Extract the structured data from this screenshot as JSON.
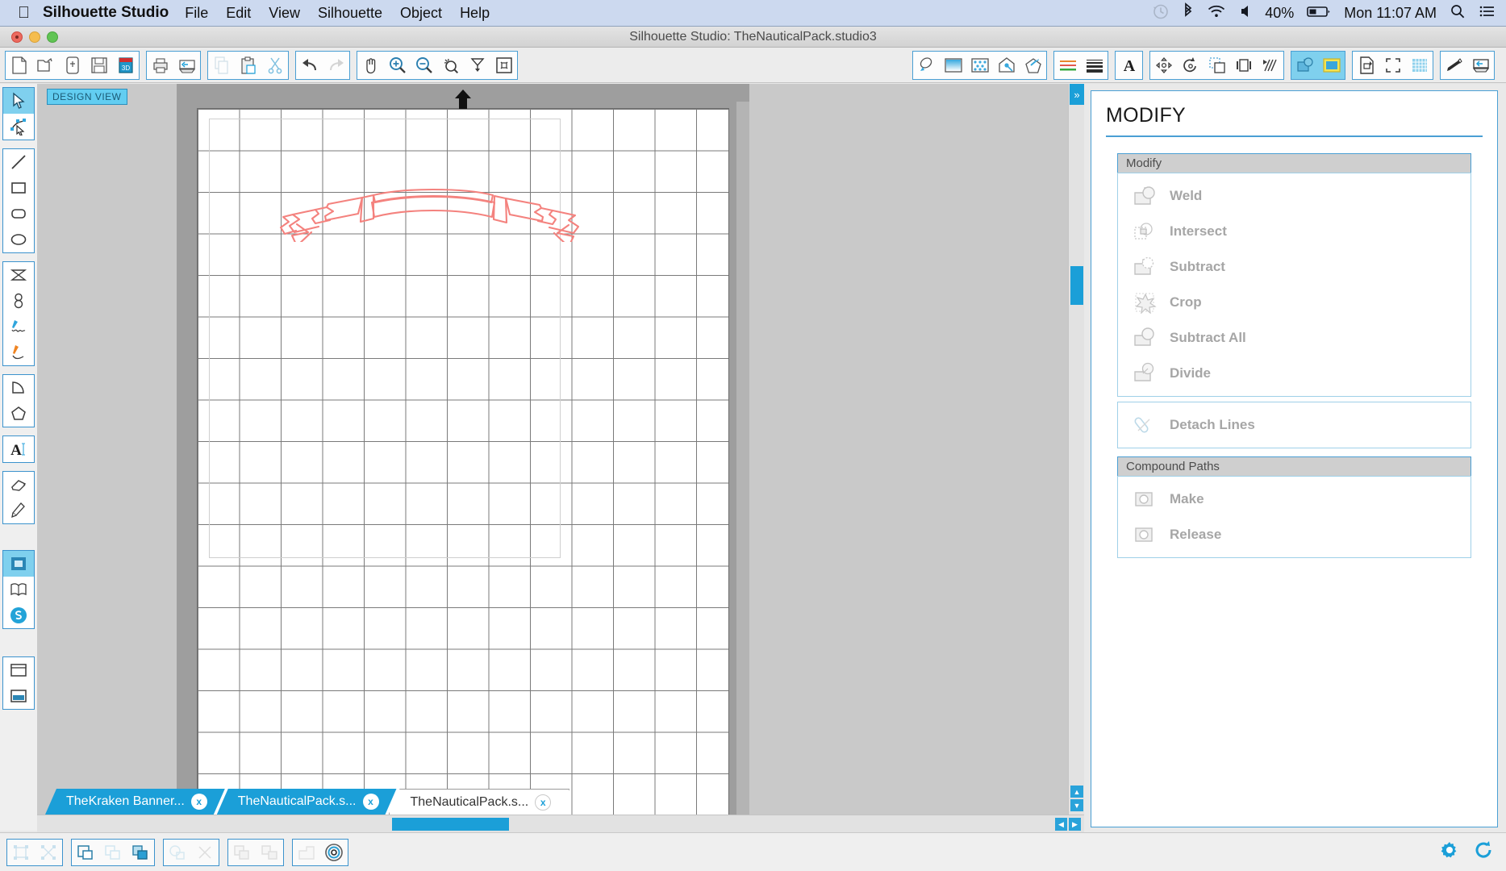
{
  "menubar": {
    "apple_icon": "apple-icon",
    "app_name": "Silhouette Studio",
    "items": [
      "File",
      "Edit",
      "View",
      "Silhouette",
      "Object",
      "Help"
    ],
    "status": {
      "timemachine_icon": "time-machine-icon",
      "bluetooth_icon": "bluetooth-icon",
      "wifi_icon": "wifi-icon",
      "volume_icon": "volume-icon",
      "battery_percent": "40%",
      "battery_icon": "battery-icon",
      "clock": "Mon 11:07 AM",
      "search_icon": "search-icon",
      "notifications_icon": "notification-list-icon"
    }
  },
  "window": {
    "title": "Silhouette Studio: TheNauticalPack.studio3",
    "close_label": "",
    "minimize_label": "",
    "zoom_label": ""
  },
  "toolbar": {
    "groups": [
      {
        "name": "file",
        "buttons": [
          {
            "name": "new-document-button",
            "icon": "new-page-icon"
          },
          {
            "name": "open-document-button",
            "icon": "open-folder-icon"
          },
          {
            "name": "open-from-library-button",
            "icon": "card-icon"
          },
          {
            "name": "save-button",
            "icon": "floppy-disk-icon"
          },
          {
            "name": "save-as-button",
            "icon": "save-as-3d-icon"
          }
        ]
      },
      {
        "name": "print",
        "buttons": [
          {
            "name": "print-button",
            "icon": "printer-icon"
          },
          {
            "name": "send-to-silhouette-button",
            "icon": "cut-send-icon"
          }
        ]
      },
      {
        "name": "clipboard",
        "buttons": [
          {
            "name": "copy-button",
            "icon": "copy-icon"
          },
          {
            "name": "paste-button",
            "icon": "paste-icon"
          },
          {
            "name": "cut-button",
            "icon": "scissors-icon"
          }
        ]
      },
      {
        "name": "history",
        "buttons": [
          {
            "name": "undo-button",
            "icon": "undo-arrow-icon"
          },
          {
            "name": "redo-button",
            "icon": "redo-arrow-icon"
          }
        ]
      },
      {
        "name": "view",
        "buttons": [
          {
            "name": "pan-tool-button",
            "icon": "hand-icon"
          },
          {
            "name": "zoom-in-button",
            "icon": "zoom-in-icon"
          },
          {
            "name": "zoom-out-button",
            "icon": "zoom-out-icon"
          },
          {
            "name": "zoom-selection-button",
            "icon": "zoom-selection-icon"
          },
          {
            "name": "fit-to-window-button",
            "icon": "fit-window-icon"
          },
          {
            "name": "fit-to-page-button",
            "icon": "fit-page-icon"
          }
        ]
      },
      {
        "name": "style",
        "buttons": [
          {
            "name": "line-color-button",
            "icon": "line-color-icon"
          },
          {
            "name": "fill-color-button",
            "icon": "fill-color-icon"
          },
          {
            "name": "pattern-fill-button",
            "icon": "pattern-fill-icon"
          },
          {
            "name": "gradient-fill-button",
            "icon": "gradient-fill-icon"
          },
          {
            "name": "sketch-fill-button",
            "icon": "sketch-pen-icon"
          }
        ]
      },
      {
        "name": "line",
        "buttons": [
          {
            "name": "line-style-button",
            "icon": "line-style-icon"
          },
          {
            "name": "line-thickness-button",
            "icon": "line-thickness-icon"
          }
        ]
      },
      {
        "name": "text",
        "buttons": [
          {
            "name": "text-style-button",
            "icon": "text-A-icon"
          }
        ]
      },
      {
        "name": "transform",
        "buttons": [
          {
            "name": "move-button",
            "icon": "move-arrows-icon"
          },
          {
            "name": "rotate-button",
            "icon": "rotate-icon"
          },
          {
            "name": "scale-button",
            "icon": "scale-icon"
          },
          {
            "name": "align-button",
            "icon": "align-icon"
          },
          {
            "name": "shear-button",
            "icon": "shear-icon"
          }
        ]
      },
      {
        "name": "panels-active",
        "buttons": [
          {
            "name": "modify-panel-button",
            "icon": "modify-icon",
            "active": true
          },
          {
            "name": "offset-panel-button",
            "icon": "offset-icon",
            "active": true
          }
        ]
      },
      {
        "name": "page",
        "buttons": [
          {
            "name": "page-setup-button",
            "icon": "page-setup-icon"
          },
          {
            "name": "registration-marks-button",
            "icon": "registration-marks-icon"
          },
          {
            "name": "grid-button",
            "icon": "grid-icon"
          }
        ]
      },
      {
        "name": "output",
        "buttons": [
          {
            "name": "pen-holder-button",
            "icon": "pen-holder-icon"
          },
          {
            "name": "cut-settings-button",
            "icon": "cut-settings-icon"
          }
        ]
      }
    ]
  },
  "left_tools": {
    "groups": [
      {
        "name": "select",
        "buttons": [
          {
            "name": "select-tool",
            "icon": "arrow-cursor-icon",
            "active": true
          },
          {
            "name": "edit-points-tool",
            "icon": "edit-points-icon"
          }
        ]
      },
      {
        "name": "shapes",
        "buttons": [
          {
            "name": "line-tool",
            "icon": "line-icon"
          },
          {
            "name": "rectangle-tool",
            "icon": "rectangle-icon"
          },
          {
            "name": "rounded-rectangle-tool",
            "icon": "rounded-rectangle-icon"
          },
          {
            "name": "ellipse-tool",
            "icon": "ellipse-icon"
          }
        ]
      },
      {
        "name": "draw",
        "buttons": [
          {
            "name": "polygon-tool",
            "icon": "polyline-icon"
          },
          {
            "name": "curve-tool",
            "icon": "curve-shape-icon"
          },
          {
            "name": "freehand-tool",
            "icon": "blue-pen-icon"
          },
          {
            "name": "smooth-freehand-tool",
            "icon": "orange-pen-icon"
          }
        ]
      },
      {
        "name": "extra-shapes",
        "buttons": [
          {
            "name": "arc-tool",
            "icon": "arc-icon"
          },
          {
            "name": "regular-polygon-tool",
            "icon": "pentagon-icon"
          }
        ]
      },
      {
        "name": "text-group",
        "buttons": [
          {
            "name": "text-tool",
            "icon": "text-cursor-A-icon"
          }
        ]
      },
      {
        "name": "erase",
        "buttons": [
          {
            "name": "eraser-tool",
            "icon": "eraser-icon"
          },
          {
            "name": "knife-tool",
            "icon": "knife-icon"
          }
        ]
      },
      {
        "name": "views",
        "buttons": [
          {
            "name": "design-view-button",
            "icon": "design-view-icon",
            "active": true
          },
          {
            "name": "library-button",
            "icon": "library-book-icon"
          },
          {
            "name": "store-button",
            "icon": "silhouette-store-icon"
          }
        ]
      },
      {
        "name": "send",
        "buttons": [
          {
            "name": "send-panel-button",
            "icon": "send-panel-icon"
          },
          {
            "name": "send-window-button",
            "icon": "send-window-icon"
          }
        ]
      }
    ]
  },
  "canvas": {
    "view_badge": "DESIGN VIEW",
    "orientation_icon": "up-arrow-icon",
    "artwork_name": "nautical-banner-ribbon",
    "artwork_stroke_color": "#f4827e",
    "grid_color": "#7a7a7a",
    "mat_background": "#ffffff",
    "scroll_accent": "#1b9fd8",
    "scroll_left_icon": "◀",
    "scroll_right_icon": "▶",
    "scroll_up_icon": "▲",
    "scroll_down_icon": "▼"
  },
  "tabs": [
    {
      "label": "TheKraken Banner...",
      "close": "x",
      "state": "active"
    },
    {
      "label": "TheNauticalPack.s...",
      "close": "x",
      "state": "active"
    },
    {
      "label": "TheNauticalPack.s...",
      "close": "x",
      "state": "current"
    }
  ],
  "panel": {
    "title": "MODIFY",
    "accent": "#4a9fd4",
    "sections": [
      {
        "header": "Modify",
        "items": [
          {
            "label": "Weld",
            "icon": "weld-icon",
            "enabled": false
          },
          {
            "label": "Intersect",
            "icon": "intersect-icon",
            "enabled": false
          },
          {
            "label": "Subtract",
            "icon": "subtract-icon",
            "enabled": false
          },
          {
            "label": "Crop",
            "icon": "crop-icon",
            "enabled": false
          },
          {
            "label": "Subtract All",
            "icon": "subtract-all-icon",
            "enabled": false
          },
          {
            "label": "Divide",
            "icon": "divide-icon",
            "enabled": false
          }
        ],
        "extra_items": [
          {
            "label": "Detach Lines",
            "icon": "detach-lines-icon",
            "enabled": false
          }
        ]
      },
      {
        "header": "Compound Paths",
        "items": [
          {
            "label": "Make",
            "icon": "make-compound-icon",
            "enabled": false
          },
          {
            "label": "Release",
            "icon": "release-compound-icon",
            "enabled": false
          }
        ]
      }
    ],
    "collapse_icon": "»"
  },
  "bottombar": {
    "groups": [
      {
        "name": "selection",
        "buttons": [
          {
            "name": "select-all-button",
            "icon": "select-all-icon"
          },
          {
            "name": "select-none-button",
            "icon": "select-none-icon"
          }
        ]
      },
      {
        "name": "arrange",
        "buttons": [
          {
            "name": "bring-to-front-button",
            "icon": "bring-to-front-icon"
          },
          {
            "name": "send-backward-button",
            "icon": "send-backward-icon"
          },
          {
            "name": "bring-forward-button",
            "icon": "bring-forward-icon"
          }
        ]
      },
      {
        "name": "modify",
        "buttons": [
          {
            "name": "weld-button",
            "icon": "weld-small-icon"
          },
          {
            "name": "release-button",
            "icon": "x-cross-icon"
          }
        ]
      },
      {
        "name": "group",
        "buttons": [
          {
            "name": "group-button",
            "icon": "group-icon"
          },
          {
            "name": "ungroup-button",
            "icon": "ungroup-icon"
          }
        ]
      },
      {
        "name": "path",
        "buttons": [
          {
            "name": "make-compound-path-button",
            "icon": "compound-path-icon"
          },
          {
            "name": "offset-button",
            "icon": "offset-rings-icon"
          }
        ]
      }
    ],
    "right_buttons": [
      {
        "name": "preferences-button",
        "icon": "gear-icon",
        "color": "#1b9fd8"
      },
      {
        "name": "sync-button",
        "icon": "sync-icon",
        "color": "#1b9fd8"
      }
    ]
  }
}
